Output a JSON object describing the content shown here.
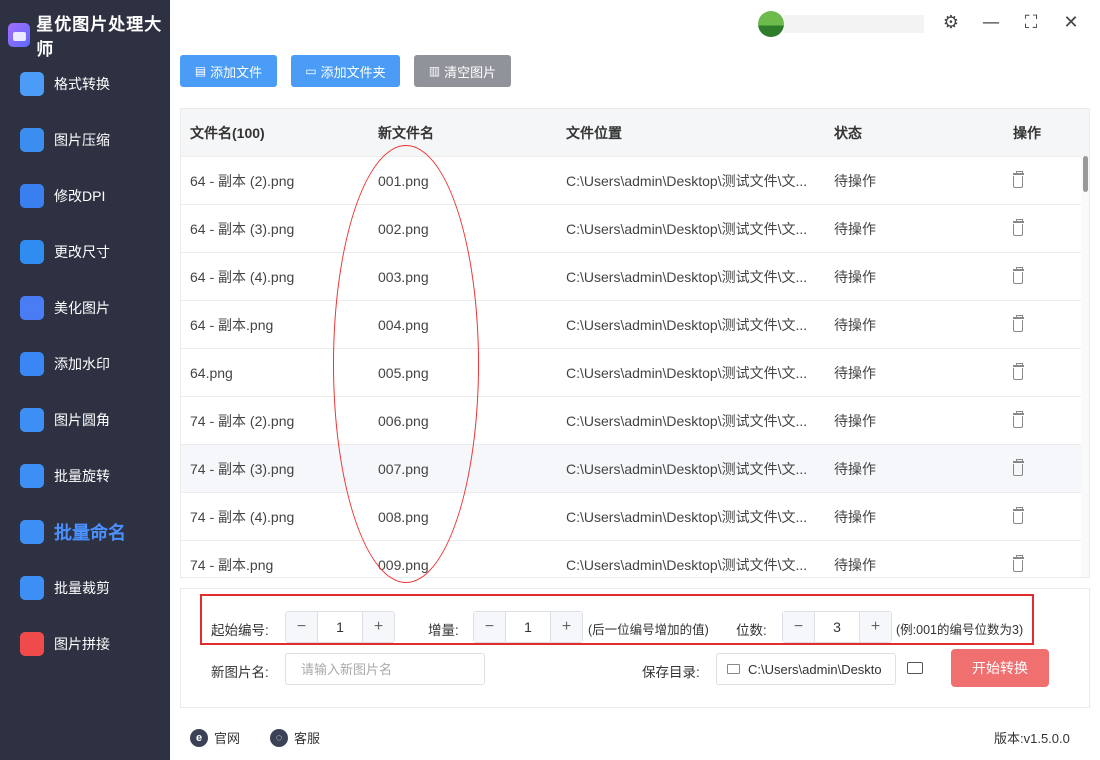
{
  "app": {
    "title": "星优图片处理大师"
  },
  "sidebar": {
    "items": [
      {
        "label": "格式转换",
        "icon": "image-convert-icon",
        "color": "#4a9cf6"
      },
      {
        "label": "图片压缩",
        "icon": "image-compress-icon",
        "color": "#3b8df0"
      },
      {
        "label": "修改DPI",
        "icon": "dpi-icon",
        "color": "#3a7ff0"
      },
      {
        "label": "更改尺寸",
        "icon": "resize-icon",
        "color": "#2f8cf0"
      },
      {
        "label": "美化图片",
        "icon": "beautify-icon",
        "color": "#4a7df5"
      },
      {
        "label": "添加水印",
        "icon": "watermark-icon",
        "color": "#3a86f5"
      },
      {
        "label": "图片圆角",
        "icon": "round-corner-icon",
        "color": "#3d8ff5"
      },
      {
        "label": "批量旋转",
        "icon": "rotate-icon",
        "color": "#3d8ff5"
      },
      {
        "label": "批量命名",
        "icon": "rename-icon",
        "color": "#3d8ff5",
        "active": true
      },
      {
        "label": "批量裁剪",
        "icon": "crop-icon",
        "color": "#3d8ff5"
      },
      {
        "label": "图片拼接",
        "icon": "stitch-icon",
        "color": "#f04a4a"
      }
    ]
  },
  "toolbar": {
    "add_file": "添加文件",
    "add_folder": "添加文件夹",
    "clear": "清空图片"
  },
  "table": {
    "headers": {
      "filename": "文件名(100)",
      "new_name": "新文件名",
      "location": "文件位置",
      "status": "状态",
      "action": "操作"
    },
    "rows": [
      {
        "filename": "64 - 副本 (2).png",
        "new_name": "001.png",
        "location": "C:\\Users\\admin\\Desktop\\测试文件\\文...",
        "status": "待操作"
      },
      {
        "filename": "64 - 副本 (3).png",
        "new_name": "002.png",
        "location": "C:\\Users\\admin\\Desktop\\测试文件\\文...",
        "status": "待操作"
      },
      {
        "filename": "64 - 副本 (4).png",
        "new_name": "003.png",
        "location": "C:\\Users\\admin\\Desktop\\测试文件\\文...",
        "status": "待操作"
      },
      {
        "filename": "64 - 副本.png",
        "new_name": "004.png",
        "location": "C:\\Users\\admin\\Desktop\\测试文件\\文...",
        "status": "待操作"
      },
      {
        "filename": "64.png",
        "new_name": "005.png",
        "location": "C:\\Users\\admin\\Desktop\\测试文件\\文...",
        "status": "待操作"
      },
      {
        "filename": "74 - 副本 (2).png",
        "new_name": "006.png",
        "location": "C:\\Users\\admin\\Desktop\\测试文件\\文...",
        "status": "待操作"
      },
      {
        "filename": "74 - 副本 (3).png",
        "new_name": "007.png",
        "location": "C:\\Users\\admin\\Desktop\\测试文件\\文...",
        "status": "待操作"
      },
      {
        "filename": "74 - 副本 (4).png",
        "new_name": "008.png",
        "location": "C:\\Users\\admin\\Desktop\\测试文件\\文...",
        "status": "待操作"
      },
      {
        "filename": "74 - 副本.png",
        "new_name": "009.png",
        "location": "C:\\Users\\admin\\Desktop\\测试文件\\文...",
        "status": "待操作"
      }
    ]
  },
  "settings": {
    "start_label": "起始编号:",
    "start_value": "1",
    "increment_label": "增量:",
    "increment_value": "1",
    "increment_hint": "(后一位编号增加的值)",
    "digits_label": "位数:",
    "digits_value": "3",
    "digits_hint": "(例:001的编号位数为3)",
    "new_name_label": "新图片名:",
    "new_name_placeholder": "请输入新图片名",
    "save_dir_label": "保存目录:",
    "save_dir_value": "C:\\Users\\admin\\Deskto",
    "start_button": "开始转换"
  },
  "footer": {
    "website": "官网",
    "support": "客服",
    "version": "版本:v1.5.0.0"
  },
  "colors": {
    "primary": "#4a9cf6",
    "sidebar_bg": "#2d3142",
    "start_button": "#f07070",
    "highlight": "#e22c2c"
  }
}
